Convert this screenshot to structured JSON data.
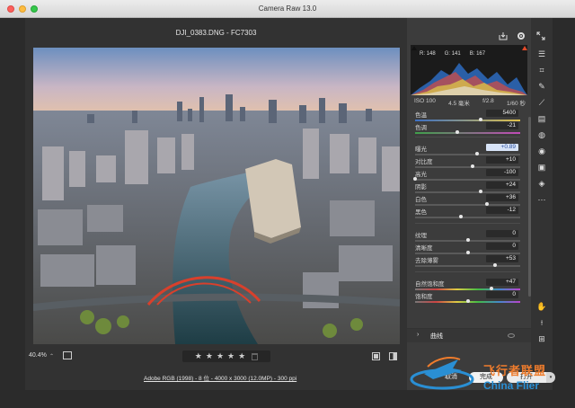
{
  "window": {
    "title": "Camera Raw 13.0"
  },
  "file": {
    "name": "DJI_0383.DNG",
    "camera": "FC7303",
    "separator": " - "
  },
  "histogram": {
    "r_label": "R:",
    "r_value": "148",
    "g_label": "G:",
    "g_value": "141",
    "b_label": "B:",
    "b_value": "167"
  },
  "camera_info": {
    "iso": "ISO 100",
    "focal": "4.5 毫米",
    "aperture": "f/2.8",
    "shutter": "1/60 秒"
  },
  "sliders": [
    {
      "id": "temp",
      "label": "色温",
      "value": "5400",
      "pos": 0.62,
      "active": false
    },
    {
      "id": "tint",
      "label": "色调",
      "value": "-21",
      "pos": 0.4,
      "active": false
    },
    {
      "id": "exposure",
      "label": "曝光",
      "value": "+0.89",
      "pos": 0.59,
      "active": true
    },
    {
      "id": "contrast",
      "label": "对比度",
      "value": "+10",
      "pos": 0.55,
      "active": false
    },
    {
      "id": "highlights",
      "label": "高光",
      "value": "-100",
      "pos": 0.0,
      "active": false
    },
    {
      "id": "shadows",
      "label": "阴影",
      "value": "+24",
      "pos": 0.62,
      "active": false
    },
    {
      "id": "whites",
      "label": "白色",
      "value": "+36",
      "pos": 0.68,
      "active": false
    },
    {
      "id": "blacks",
      "label": "黑色",
      "value": "-12",
      "pos": 0.44,
      "active": false
    },
    {
      "id": "texture",
      "label": "纹理",
      "value": "0",
      "pos": 0.5,
      "active": false
    },
    {
      "id": "clarity",
      "label": "清晰度",
      "value": "0",
      "pos": 0.5,
      "active": false
    },
    {
      "id": "dehaze",
      "label": "去除薄雾",
      "value": "+53",
      "pos": 0.76,
      "active": false
    },
    {
      "id": "vibrance",
      "label": "自然饱和度",
      "value": "+47",
      "pos": 0.73,
      "active": false
    },
    {
      "id": "saturation",
      "label": "饱和度",
      "value": "0",
      "pos": 0.5,
      "active": false
    }
  ],
  "curve_section": {
    "arrow": "›",
    "label": "曲线"
  },
  "bottom_bar": {
    "zoom": "40.4%",
    "zoom_caret": "⌃",
    "stars": [
      "★",
      "★",
      "★",
      "★",
      "★"
    ]
  },
  "footer": {
    "workflow": "Adobe RGB (1998) - 8 位 - 4000 x 3000 (12.0MP) - 300 ppi",
    "cancel": "取消",
    "done": "完成",
    "open": "打开",
    "open_menu": "▾"
  },
  "toolbar": {
    "icons": [
      "sliders-icon",
      "crop-icon",
      "spot-heal-icon",
      "brush-icon",
      "gradient-icon",
      "radial-filter-icon",
      "redeye-icon",
      "snapshots-icon",
      "presets-icon",
      "more-icon"
    ],
    "bottom_icons": [
      "hand-icon",
      "eyedropper-icon",
      "grid-icon"
    ]
  },
  "header_icons": [
    "save-icon",
    "settings-icon",
    "fullscreen-icon"
  ],
  "watermark": {
    "zh": "飞行者联盟",
    "en": "China Flier"
  },
  "colors": {
    "accent_clip": "#e04a2a",
    "active_value_bg": "#d8e4f8",
    "watermark_orange": "#ef7c2c",
    "watermark_blue": "#2a8fd4"
  }
}
